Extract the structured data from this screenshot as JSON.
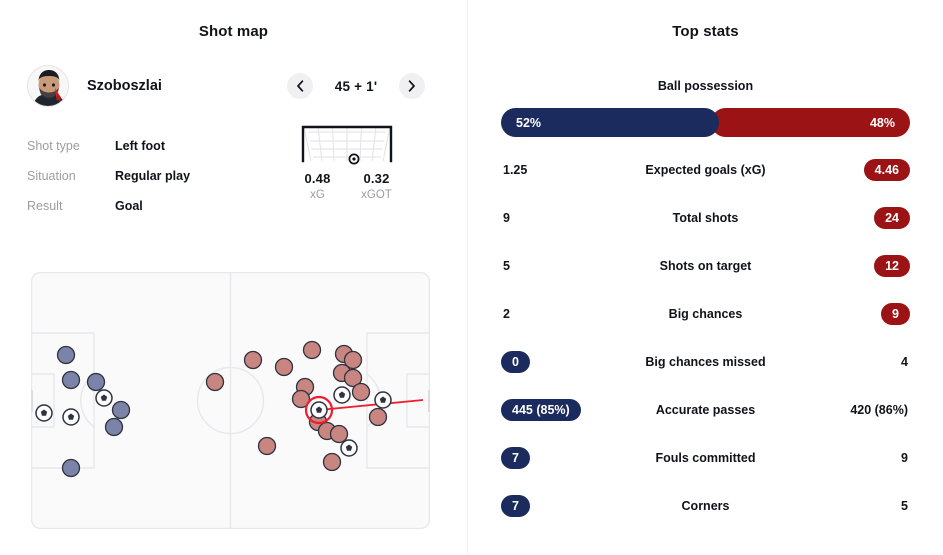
{
  "shotmap": {
    "title": "Shot map",
    "player": {
      "name": "Szoboszlai",
      "avatar_icon": "player-avatar"
    },
    "nav": {
      "prev_icon": "chevron-left-icon",
      "next_icon": "chevron-right-icon",
      "minute": "45 + 1'"
    },
    "details": [
      {
        "key": "Shot type",
        "value": "Left foot"
      },
      {
        "key": "Situation",
        "value": "Regular play"
      },
      {
        "key": "Result",
        "value": "Goal"
      }
    ],
    "goal_widget": {
      "xg_value": "0.48",
      "xg_label": "xG",
      "xgot_value": "0.32",
      "xgot_label": "xGOT",
      "ball_icon": "goal-ball-marker"
    },
    "pitch": {
      "home_color": "#7b84a8",
      "away_color": "#c98580",
      "highlight_color": "#f01e2c"
    }
  },
  "topstats": {
    "title": "Top stats",
    "possession": {
      "label": "Ball possession",
      "home": "52%",
      "away": "48%",
      "home_color": "#1c2b5e",
      "away_color": "#9b1315"
    },
    "rows": [
      {
        "label": "Expected goals (xG)",
        "home": "1.25",
        "away": "4.46",
        "home_pill": false,
        "away_pill": true
      },
      {
        "label": "Total shots",
        "home": "9",
        "away": "24",
        "home_pill": false,
        "away_pill": true
      },
      {
        "label": "Shots on target",
        "home": "5",
        "away": "12",
        "home_pill": false,
        "away_pill": true
      },
      {
        "label": "Big chances",
        "home": "2",
        "away": "9",
        "home_pill": false,
        "away_pill": true
      },
      {
        "label": "Big chances missed",
        "home": "0",
        "away": "4",
        "home_pill": true,
        "away_pill": false
      },
      {
        "label": "Accurate passes",
        "home": "445 (85%)",
        "away": "420 (86%)",
        "home_pill": true,
        "away_pill": false
      },
      {
        "label": "Fouls committed",
        "home": "7",
        "away": "9",
        "home_pill": true,
        "away_pill": false
      },
      {
        "label": "Corners",
        "home": "7",
        "away": "5",
        "home_pill": true,
        "away_pill": false
      }
    ]
  },
  "chart_data": {
    "type": "scatter",
    "title": "Shot map",
    "xlabel": "",
    "ylabel": "",
    "xlim": [
      0,
      399
    ],
    "ylim": [
      0,
      257
    ],
    "grid": false,
    "legend": "none",
    "series": [
      {
        "name": "Home shots",
        "color": "#7b84a8",
        "points": [
          {
            "x": 35,
            "y": 83,
            "type": "dot"
          },
          {
            "x": 65,
            "y": 110,
            "type": "dot"
          },
          {
            "x": 62,
            "y": 49,
            "type": "dot"
          },
          {
            "x": 13,
            "y": 137,
            "type": "dot"
          },
          {
            "x": 40,
            "y": 144,
            "type": "dot"
          },
          {
            "x": 73,
            "y": 126,
            "type": "dot"
          },
          {
            "x": 90,
            "y": 138,
            "type": "dot"
          },
          {
            "x": 83,
            "y": 158,
            "type": "dot"
          },
          {
            "x": 40,
            "y": 196,
            "type": "dot"
          }
        ],
        "goal_points": [
          {
            "x": 13,
            "y": 137,
            "type": "ball"
          },
          {
            "x": 40,
            "y": 144,
            "type": "ball"
          },
          {
            "x": 73,
            "y": 126,
            "type": "ball"
          }
        ]
      },
      {
        "name": "Away shots",
        "color": "#c98580",
        "points": [
          {
            "x": 281,
            "y": 78,
            "type": "dot"
          },
          {
            "x": 313,
            "y": 82,
            "type": "dot"
          },
          {
            "x": 321,
            "y": 86,
            "type": "dot"
          },
          {
            "x": 313,
            "y": 98,
            "type": "dot"
          },
          {
            "x": 322,
            "y": 105,
            "type": "dot"
          },
          {
            "x": 253,
            "y": 95,
            "type": "dot"
          },
          {
            "x": 222,
            "y": 88,
            "type": "dot"
          },
          {
            "x": 184,
            "y": 110,
            "type": "dot"
          },
          {
            "x": 274,
            "y": 115,
            "type": "dot"
          },
          {
            "x": 270,
            "y": 127,
            "type": "dot"
          },
          {
            "x": 347,
            "y": 145,
            "type": "dot"
          },
          {
            "x": 287,
            "y": 150,
            "type": "dot"
          },
          {
            "x": 295,
            "y": 160,
            "type": "dot"
          },
          {
            "x": 307,
            "y": 162,
            "type": "dot"
          },
          {
            "x": 236,
            "y": 174,
            "type": "dot"
          },
          {
            "x": 301,
            "y": 190,
            "type": "dot"
          },
          {
            "x": 330,
            "y": 120,
            "type": "dot"
          }
        ],
        "goal_points": [
          {
            "x": 311,
            "y": 123,
            "type": "ball"
          },
          {
            "x": 352,
            "y": 128,
            "type": "ball"
          },
          {
            "x": 318,
            "y": 175,
            "type": "ball"
          }
        ],
        "highlighted": {
          "x": 288,
          "y": 138,
          "type": "ball-highlight"
        }
      }
    ]
  }
}
